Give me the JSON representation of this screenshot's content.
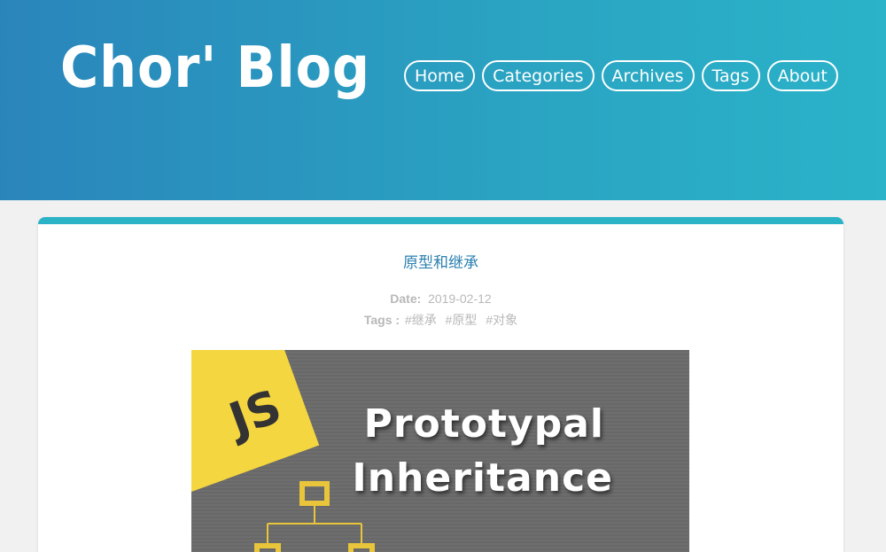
{
  "header": {
    "site_title": "Chor' Blog",
    "nav": [
      {
        "label": "Home"
      },
      {
        "label": "Categories"
      },
      {
        "label": "Archives"
      },
      {
        "label": "Tags"
      },
      {
        "label": "About"
      }
    ]
  },
  "post": {
    "title": "原型和继承",
    "date_label": "Date:",
    "date": "2019-02-12",
    "tags_label": "Tags :",
    "tags": [
      "#继承",
      "#原型",
      "#对象"
    ],
    "hero": {
      "badge": "JS",
      "line1": "Prototypal",
      "line2": "Inheritance"
    }
  },
  "colors": {
    "header_start": "#2a85bb",
    "header_end": "#2ab3c9",
    "accent": "#2ab2c6",
    "title_link": "#2a7fb0",
    "badge": "#f4d640"
  }
}
